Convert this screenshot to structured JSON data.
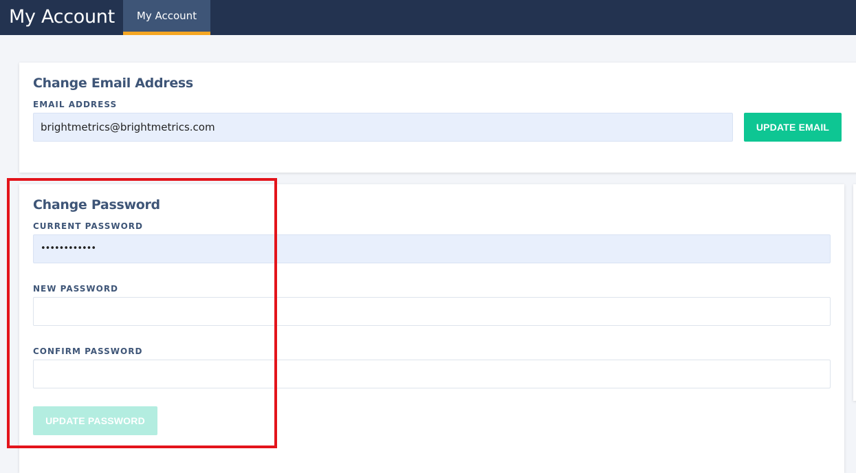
{
  "header": {
    "title": "My Account",
    "tabs": [
      {
        "label": "My Account",
        "active": true
      }
    ]
  },
  "email_section": {
    "title": "Change Email Address",
    "email_label": "EMAIL ADDRESS",
    "email_value": "brightmetrics@brightmetrics.com",
    "button_label": "UPDATE EMAIL"
  },
  "password_section": {
    "title": "Change Password",
    "current_label": "CURRENT PASSWORD",
    "current_value": "••••••••••••",
    "new_label": "NEW PASSWORD",
    "new_value": "",
    "confirm_label": "CONFIRM PASSWORD",
    "confirm_value": "",
    "button_label": "UPDATE PASSWORD",
    "button_disabled": true
  },
  "colors": {
    "topbar": "#233350",
    "tab_active": "#3e5577",
    "tab_indicator": "#f5a623",
    "primary_button": "#0ec693",
    "disabled_button": "#b3ede0",
    "annotation_box": "#e3141b"
  }
}
